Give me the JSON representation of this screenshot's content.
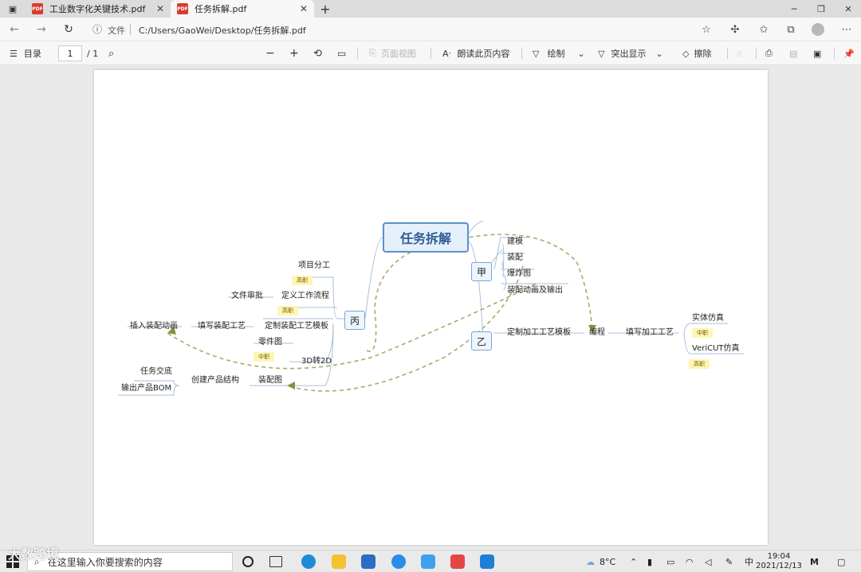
{
  "tabs": [
    {
      "label": "工业数字化关键技术.pdf",
      "active": false
    },
    {
      "label": "任务拆解.pdf",
      "active": true
    }
  ],
  "address": {
    "file_label": "文件",
    "url": "C:/Users/GaoWei/Desktop/任务拆解.pdf"
  },
  "pdf_toolbar": {
    "toc_label": "目录",
    "page_current": "1",
    "page_total": "/ 1",
    "page_view_label": "页面视图",
    "read_aloud_label": "朗读此页内容",
    "draw_label": "绘制",
    "highlight_label": "突出显示",
    "erase_label": "擦除"
  },
  "mindmap": {
    "root": "任务拆解",
    "branches": {
      "jia": "甲",
      "yi": "乙",
      "bing": "丙"
    },
    "jia_children": [
      "建模",
      "装配",
      "爆炸图",
      "装配动画及输出"
    ],
    "yi_children": {
      "template": "定制加工工艺模板",
      "programming": "编程",
      "fill_process": "填写加工工艺",
      "solid_sim": "实体仿真",
      "vericut_sim": "VeriCUT仿真"
    },
    "bing_children": {
      "project": "项目分工",
      "define_flow": "定义工作流程",
      "doc_approval": "文件审批",
      "custom_assembly_template": "定制装配工艺模板",
      "fill_assembly": "填写装配工艺",
      "insert_animation": "插入装配动画",
      "part_drawing": "零件图",
      "convert_3d2d": "3D转2D",
      "assembly_drawing": "装配图",
      "create_structure": "创建产品结构",
      "task_handover": "任务交底",
      "output_bom": "输出产品BOM"
    },
    "tags": {
      "senior": "高职",
      "middle": "中职"
    }
  },
  "taskbar": {
    "search_placeholder": "在这里输入你要搜索的内容",
    "temperature": "8°C",
    "ime": "中",
    "time": "19:04",
    "date": "2021/12/13"
  },
  "watermark": "大数跨境"
}
